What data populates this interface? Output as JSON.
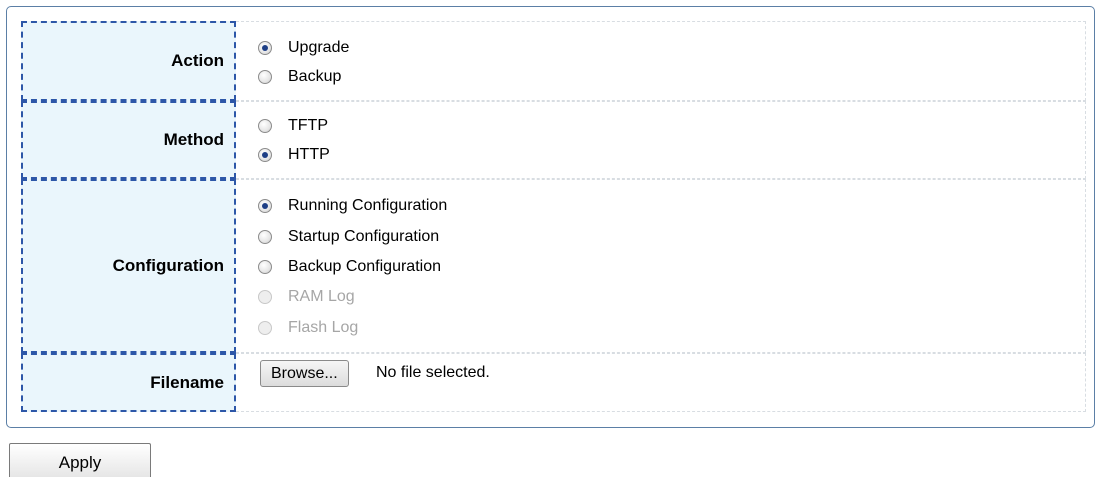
{
  "form": {
    "action": {
      "label": "Action",
      "options": [
        {
          "label": "Upgrade",
          "checked": true,
          "disabled": false
        },
        {
          "label": "Backup",
          "checked": false,
          "disabled": false
        }
      ]
    },
    "method": {
      "label": "Method",
      "options": [
        {
          "label": "TFTP",
          "checked": false,
          "disabled": false
        },
        {
          "label": "HTTP",
          "checked": true,
          "disabled": false
        }
      ]
    },
    "configuration": {
      "label": "Configuration",
      "options": [
        {
          "label": "Running Configuration",
          "checked": true,
          "disabled": false
        },
        {
          "label": "Startup Configuration",
          "checked": false,
          "disabled": false
        },
        {
          "label": "Backup Configuration",
          "checked": false,
          "disabled": false
        },
        {
          "label": "RAM Log",
          "checked": false,
          "disabled": true
        },
        {
          "label": "Flash Log",
          "checked": false,
          "disabled": true
        }
      ]
    },
    "filename": {
      "label": "Filename",
      "browse_label": "Browse...",
      "status": "No file selected."
    }
  },
  "apply_label": "Apply"
}
